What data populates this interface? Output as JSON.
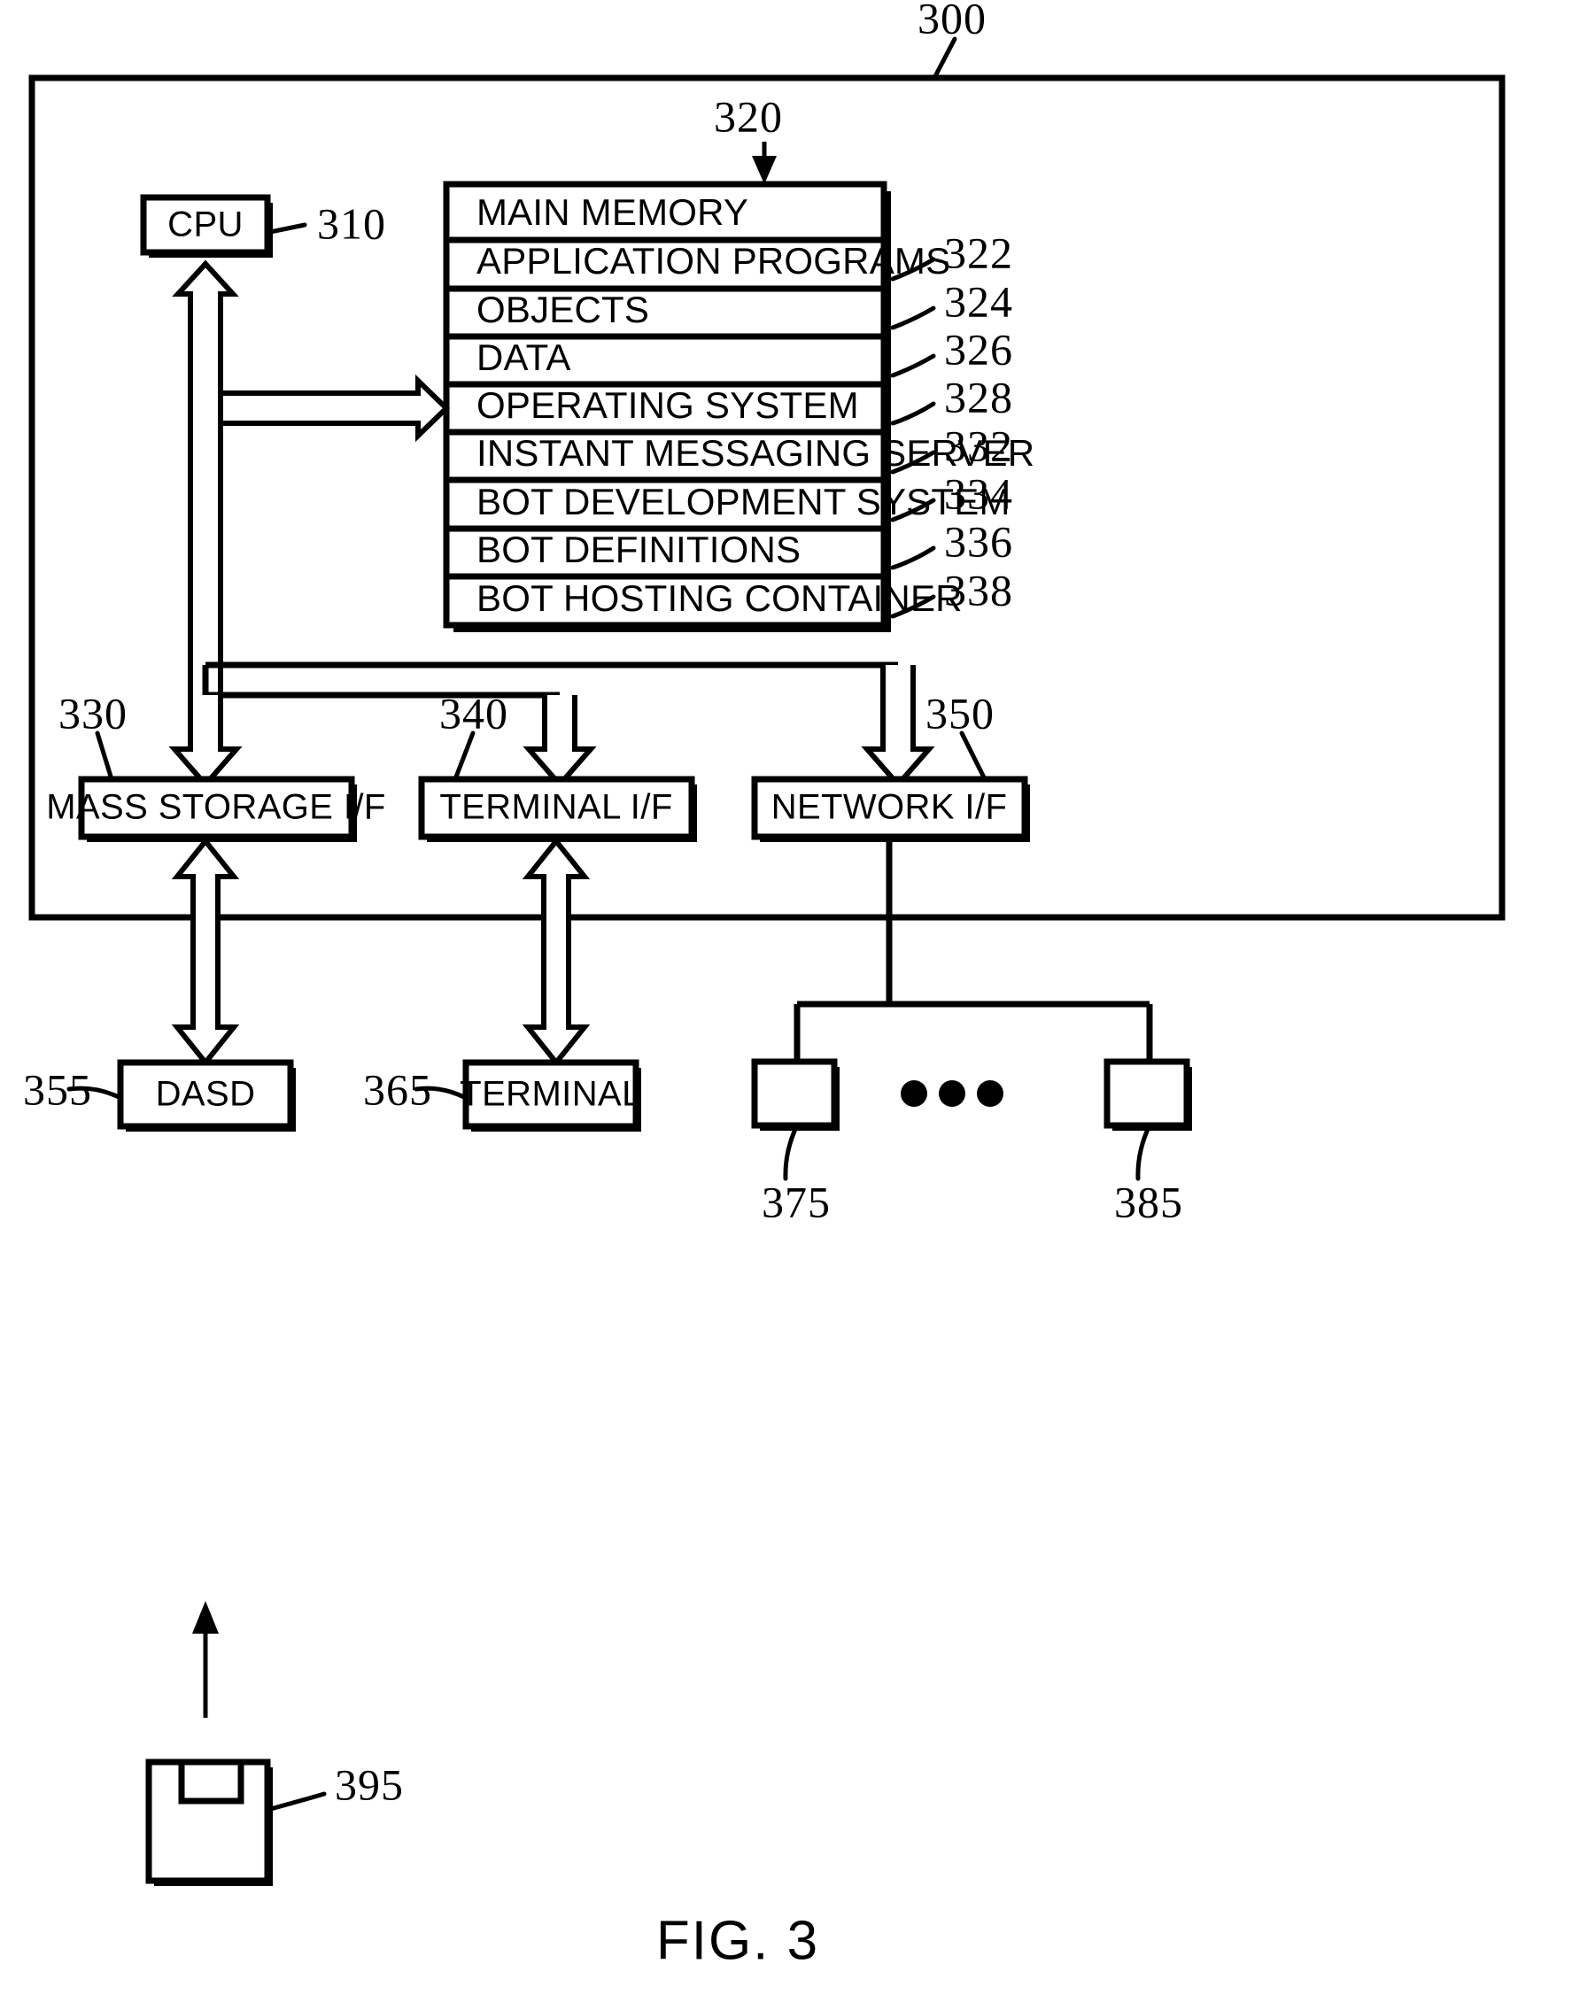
{
  "figure": {
    "caption": "FIG. 3",
    "system_ref": "300",
    "memory_ref": "320"
  },
  "cpu": {
    "label": "CPU",
    "ref": "310"
  },
  "main_memory": {
    "rows": [
      {
        "label": "MAIN MEMORY",
        "ref": ""
      },
      {
        "label": "APPLICATION PROGRAMS",
        "ref": "322"
      },
      {
        "label": "OBJECTS",
        "ref": "324"
      },
      {
        "label": "DATA",
        "ref": "326"
      },
      {
        "label": "OPERATING SYSTEM",
        "ref": "328"
      },
      {
        "label": "INSTANT MESSAGING SERVER",
        "ref": "332"
      },
      {
        "label": "BOT DEVELOPMENT SYSTEM",
        "ref": "334"
      },
      {
        "label": "BOT DEFINITIONS",
        "ref": "336"
      },
      {
        "label": "BOT HOSTING CONTAINER",
        "ref": "338"
      }
    ]
  },
  "interfaces": [
    {
      "label": "MASS STORAGE I/F",
      "ref": "330"
    },
    {
      "label": "TERMINAL I/F",
      "ref": "340"
    },
    {
      "label": "NETWORK I/F",
      "ref": "350"
    }
  ],
  "peripherals": [
    {
      "label": "DASD",
      "ref": "355"
    },
    {
      "label": "TERMINAL",
      "ref": "365"
    }
  ],
  "network_nodes": [
    {
      "label": "",
      "ref": "375"
    },
    {
      "label": "",
      "ref": "385"
    }
  ],
  "network_ellipsis": "• • •",
  "removable_media": {
    "label": "",
    "ref": "395"
  },
  "colors": {
    "ink": "#000000",
    "paper": "#ffffff"
  }
}
